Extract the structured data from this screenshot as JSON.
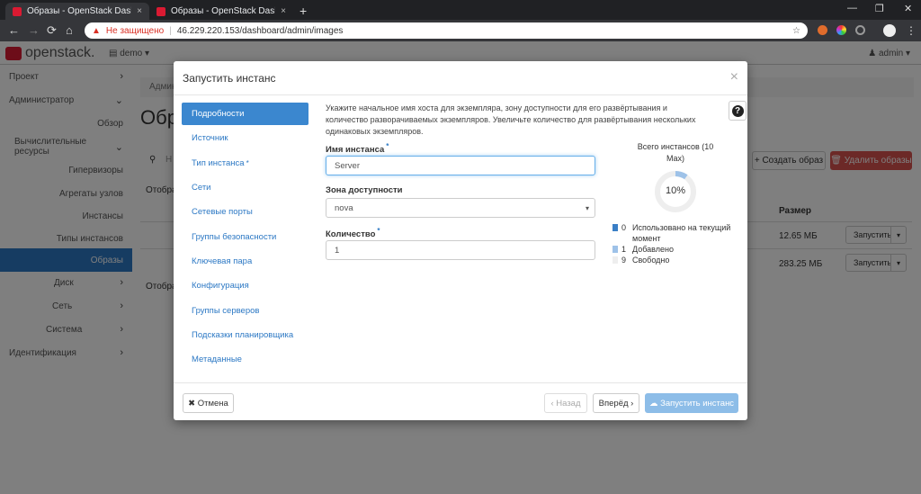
{
  "browser": {
    "tabs": [
      {
        "title": "Образы - OpenStack Dashboard",
        "close": "×"
      },
      {
        "title": "Образы - OpenStack Dashboard",
        "close": "×"
      }
    ],
    "new_tab": "+",
    "window_controls": {
      "minimize": "—",
      "restore": "❐",
      "close": "✕"
    },
    "nav": {
      "back": "←",
      "forward": "→",
      "reload": "⟳",
      "home": "⌂"
    },
    "address": {
      "security_icon": "▲",
      "security_text": "Не защищено",
      "separator": "|",
      "url": "46.229.220.153/dashboard/admin/images",
      "bookmark": "☆"
    },
    "menu": "⋮"
  },
  "header": {
    "logo_text": "openstack.",
    "project": "▤ demo ▾",
    "user": "♟ admin ▾"
  },
  "sidebar": {
    "items": [
      {
        "label": "Проект",
        "chevron": "›"
      },
      {
        "label": "Администратор",
        "chevron": "⌄"
      },
      {
        "label": "Обзор"
      },
      {
        "label": "Вычислительные ресурсы",
        "chevron": "⌄"
      },
      {
        "label": "Гипервизоры"
      },
      {
        "label": "Агрегаты узлов"
      },
      {
        "label": "Инстансы"
      },
      {
        "label": "Типы инстансов"
      },
      {
        "label": "Образы"
      },
      {
        "label": "Диск",
        "chevron": "›"
      },
      {
        "label": "Сеть",
        "chevron": "›"
      },
      {
        "label": "Система",
        "chevron": "›"
      },
      {
        "label": "Идентификация",
        "chevron": "›"
      }
    ]
  },
  "background": {
    "breadcrumb": "Админ",
    "page_title": "Обр",
    "search_icon": "⚲",
    "search_text": "Н",
    "displayed_1": "Отобра",
    "displayed_2": "Отобра",
    "create_image": "+ Создать образ",
    "delete_images": "🗑 Удалить образы",
    "size_header": "Размер",
    "rows": [
      {
        "size": "12.65 МБ",
        "launch": "Запустить",
        "caret": "▾"
      },
      {
        "size": "283.25 МБ",
        "launch": "Запустить",
        "caret": "▾"
      }
    ]
  },
  "modal": {
    "title": "Запустить инстанс",
    "close": "×",
    "steps": [
      {
        "label": "Подробности",
        "required": false
      },
      {
        "label": "Источник",
        "required": false
      },
      {
        "label": "Тип инстанса",
        "required": true
      },
      {
        "label": "Сети",
        "required": false
      },
      {
        "label": "Сетевые порты",
        "required": false
      },
      {
        "label": "Группы безопасности",
        "required": false
      },
      {
        "label": "Ключевая пара",
        "required": false
      },
      {
        "label": "Конфигурация",
        "required": false
      },
      {
        "label": "Группы серверов",
        "required": false
      },
      {
        "label": "Подсказки планировщика",
        "required": false
      },
      {
        "label": "Метаданные",
        "required": false
      }
    ],
    "required_mark": "*",
    "intro": "Укажите начальное имя хоста для экземпляра, зону доступности для его развёртывания и количество разворачиваемых экземпляров. Увеличьте количество для развёртывания нескольких одинаковых экземпляров.",
    "help": "?",
    "fields": {
      "instance_name": {
        "label": "Имя инстанса",
        "value": "Server"
      },
      "availability_zone": {
        "label": "Зона доступности",
        "value": "nova",
        "caret": "▾"
      },
      "count": {
        "label": "Количество",
        "value": "1"
      }
    },
    "quota": {
      "title": "Всего инстансов (10 Max)",
      "percent_label": "10%",
      "percent": 0.1,
      "legend": [
        {
          "count": "0",
          "label": "Использовано на текущий момент",
          "color": "#3a7fc6"
        },
        {
          "count": "1",
          "label": "Добавлено",
          "color": "#9ec2e8"
        },
        {
          "count": "9",
          "label": "Свободно",
          "color": "#eeeeee"
        }
      ]
    },
    "footer": {
      "cancel": "✖ Отмена",
      "back": "‹ Назад",
      "next": "Вперёд ›",
      "launch": "☁ Запустить инстанс"
    }
  }
}
